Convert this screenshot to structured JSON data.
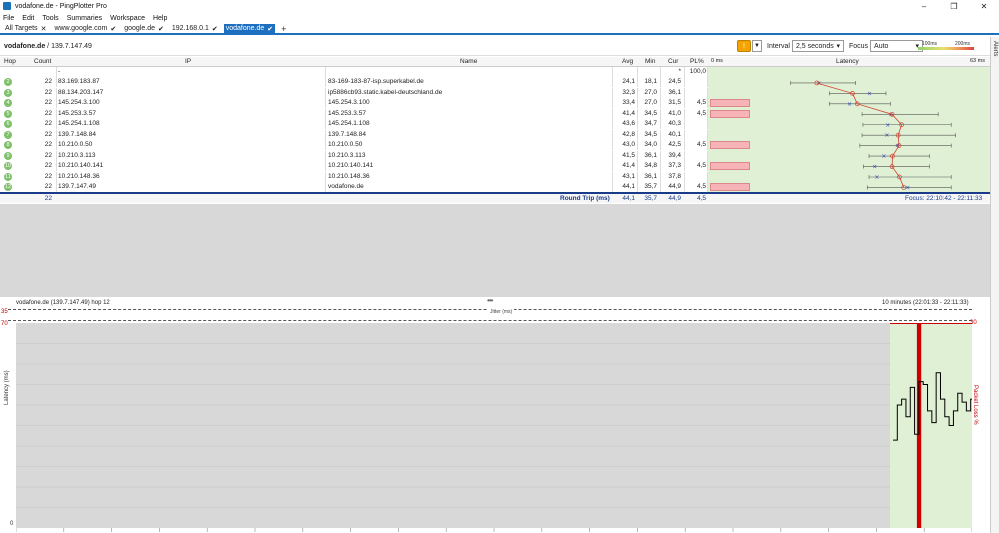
{
  "window": {
    "title": "vodafone.de - PingPlotter Pro",
    "controls": [
      "–",
      "❐",
      "✕"
    ]
  },
  "menu": [
    "File",
    "Edit",
    "Tools",
    "Summaries",
    "Workspace",
    "Help"
  ],
  "tabs": [
    {
      "label": "All Targets",
      "mark": "✕",
      "active": false
    },
    {
      "label": "www.google.com",
      "mark": "✔",
      "active": false
    },
    {
      "label": "google.de",
      "mark": "✔",
      "active": false
    },
    {
      "label": "192.168.0.1",
      "mark": "✔",
      "active": false
    },
    {
      "label": "vodafone.de",
      "mark": "✔",
      "active": true
    }
  ],
  "tab_add": "+",
  "header": {
    "target_name": "vodafone.de",
    "target_ip": " / 139.7.147.49",
    "pause_icon": "!",
    "interval_label": "Interval",
    "interval_value": "2,5 seconds",
    "focus_label": "Focus",
    "focus_value": "Auto",
    "scale_low": "100ms",
    "scale_high": "200ms",
    "alerts": "Alerts"
  },
  "columns": {
    "hop": "Hop",
    "count": "Count",
    "ip": "IP",
    "name": "Name",
    "avg": "Avg",
    "min": "Min",
    "cur": "Cur",
    "pl": "PL%",
    "latency_min": "0 ms",
    "latency": "Latency",
    "latency_max": "63 ms"
  },
  "hops": [
    {
      "hop": "1",
      "count": "",
      "ip": "-",
      "name": "",
      "avg": "",
      "min": "",
      "cur": "*",
      "pl": "100,0",
      "loss": false,
      "avg_ms": null,
      "min_ms": null,
      "max_ms": null,
      "cur_ms": null
    },
    {
      "hop": "2",
      "count": "22",
      "ip": "83.169.183.87",
      "name": "83-169-183-87-isp.superkabel.de",
      "avg": "24,1",
      "min": "18,1",
      "cur": "24,5",
      "pl": "",
      "loss": false,
      "avg_ms": 24.1,
      "min_ms": 18.1,
      "max_ms": 33,
      "cur_ms": 24.5
    },
    {
      "hop": "3",
      "count": "22",
      "ip": "88.134.203.147",
      "name": "ip5886cb93.static.kabel-deutschland.de",
      "avg": "32,3",
      "min": "27,0",
      "cur": "36,1",
      "pl": "",
      "loss": false,
      "avg_ms": 32.3,
      "min_ms": 27.0,
      "max_ms": 40,
      "cur_ms": 36.1
    },
    {
      "hop": "4",
      "count": "22",
      "ip": "145.254.3.100",
      "name": "145.254.3.100",
      "avg": "33,4",
      "min": "27,0",
      "cur": "31,5",
      "pl": "4,5",
      "loss": true,
      "avg_ms": 33.4,
      "min_ms": 27.0,
      "max_ms": 41,
      "cur_ms": 31.5
    },
    {
      "hop": "5",
      "count": "22",
      "ip": "145.253.3.57",
      "name": "145.253.3.57",
      "avg": "41,4",
      "min": "34,5",
      "cur": "41,0",
      "pl": "4,5",
      "loss": true,
      "avg_ms": 41.4,
      "min_ms": 34.5,
      "max_ms": 52,
      "cur_ms": 41.0
    },
    {
      "hop": "6",
      "count": "22",
      "ip": "145.254.1.108",
      "name": "145.254.1.108",
      "avg": "43,6",
      "min": "34,7",
      "cur": "40,3",
      "pl": "",
      "loss": false,
      "avg_ms": 43.6,
      "min_ms": 34.7,
      "max_ms": 55,
      "cur_ms": 40.3
    },
    {
      "hop": "7",
      "count": "22",
      "ip": "139.7.148.84",
      "name": "139.7.148.84",
      "avg": "42,8",
      "min": "34,5",
      "cur": "40,1",
      "pl": "",
      "loss": false,
      "avg_ms": 42.8,
      "min_ms": 34.5,
      "max_ms": 56,
      "cur_ms": 40.1
    },
    {
      "hop": "8",
      "count": "22",
      "ip": "10.210.0.50",
      "name": "10.210.0.50",
      "avg": "43,0",
      "min": "34,0",
      "cur": "42,5",
      "pl": "4,5",
      "loss": true,
      "avg_ms": 43.0,
      "min_ms": 34.0,
      "max_ms": 55,
      "cur_ms": 42.5
    },
    {
      "hop": "9",
      "count": "22",
      "ip": "10.210.3.113",
      "name": "10.210.3.113",
      "avg": "41,5",
      "min": "36,1",
      "cur": "39,4",
      "pl": "",
      "loss": false,
      "avg_ms": 41.5,
      "min_ms": 36.1,
      "max_ms": 50,
      "cur_ms": 39.4
    },
    {
      "hop": "10",
      "count": "22",
      "ip": "10.210.140.141",
      "name": "10.210.140.141",
      "avg": "41,4",
      "min": "34,8",
      "cur": "37,3",
      "pl": "4,5",
      "loss": true,
      "avg_ms": 41.4,
      "min_ms": 34.8,
      "max_ms": 50,
      "cur_ms": 37.3
    },
    {
      "hop": "11",
      "count": "22",
      "ip": "10.210.148.36",
      "name": "10.210.148.36",
      "avg": "43,1",
      "min": "36,1",
      "cur": "37,8",
      "pl": "",
      "loss": false,
      "avg_ms": 43.1,
      "min_ms": 36.1,
      "max_ms": 55,
      "cur_ms": 37.8
    },
    {
      "hop": "12",
      "count": "22",
      "ip": "139.7.147.49",
      "name": "vodafone.de",
      "avg": "44,1",
      "min": "35,7",
      "cur": "44,9",
      "pl": "4,5",
      "loss": true,
      "avg_ms": 44.1,
      "min_ms": 35.7,
      "max_ms": 55,
      "cur_ms": 44.9
    }
  ],
  "latency_scale_max_ms": 63,
  "summary": {
    "count": "22",
    "label": "Round Trip (ms)",
    "avg": "44,1",
    "min": "35,7",
    "cur": "44,9",
    "pl": "4,5",
    "focus": "Focus: 22:10:42 - 22:11:33"
  },
  "graph": {
    "title": "vodafone.de (139.7.147.49) hop 12",
    "range": "10 minutes (22:01:33 - 22:11:33)",
    "jitter_label": "Jitter (ms)",
    "jitter_axis": "35",
    "y_max": "70",
    "y_min": "0",
    "loss_axis": "30",
    "ylabel": "Latency (ms)",
    "ylabel_right": "Packet Loss %",
    "grip": "•••",
    "colors": {
      "background": "#d8d8d8",
      "focus": "#dff0d4",
      "loss": "#d00000",
      "line": "#000000"
    },
    "samples_ms": [
      30,
      42,
      44,
      38,
      48,
      32,
      50,
      49,
      40,
      36,
      53,
      44,
      38,
      35,
      40,
      46,
      43,
      40,
      44
    ],
    "loss_sample_index": 6
  }
}
